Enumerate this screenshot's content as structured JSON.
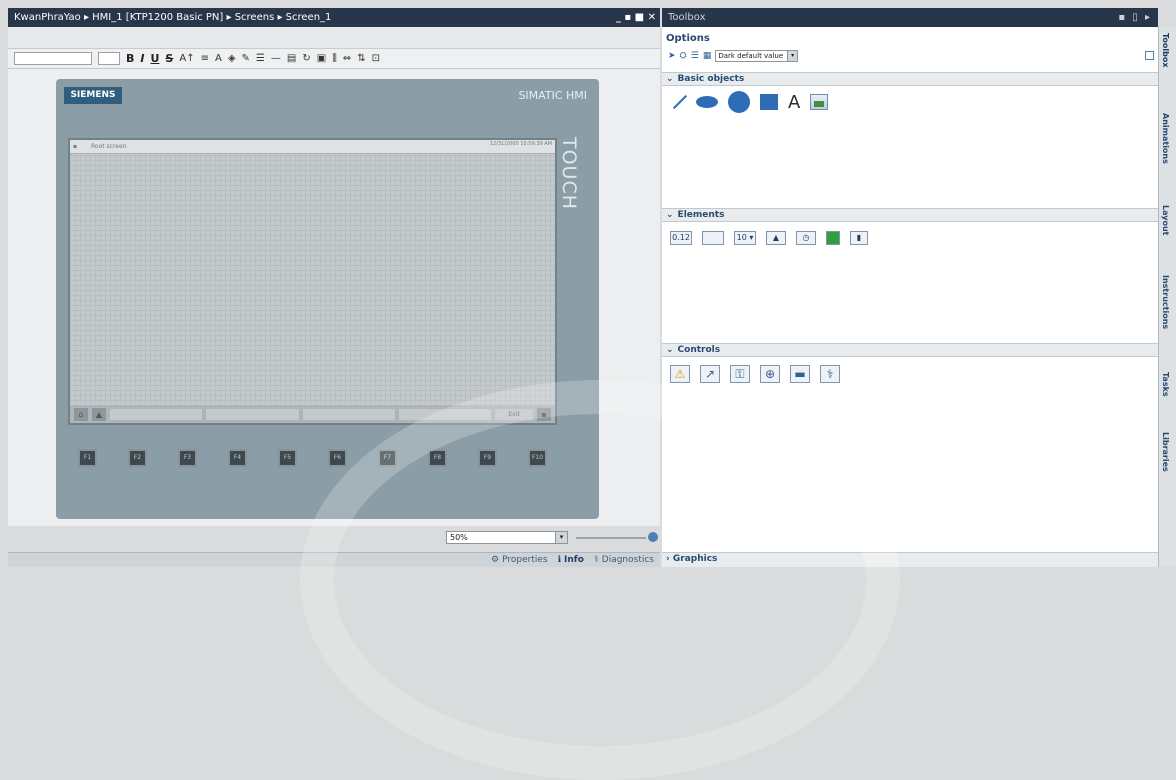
{
  "window": {
    "breadcrumb": "KwanPhraYao  ▸  HMI_1 [KTP1200 Basic PN]  ▸  Screens  ▸  Screen_1",
    "controls": "_ ▪ ■ ✕"
  },
  "toolbox_panel": {
    "title": "Toolbox",
    "controls": "▪ ▯ ▸"
  },
  "options": {
    "heading": "Options",
    "style_value": "Dark default value"
  },
  "sections": {
    "basic_objects": "Basic objects",
    "elements": "Elements",
    "controls": "Controls",
    "graphics": "Graphics"
  },
  "elements_icons": [
    "0.12",
    "",
    "10 ▾",
    "",
    "",
    "",
    ""
  ],
  "device": {
    "brand": "SIEMENS",
    "model": "SIMATIC HMI",
    "touch": "TOUCH",
    "screen_header": "Root screen",
    "screen_date": "12/31/2000 10:59:39 AM",
    "exit_label": "Exit",
    "fkeys": [
      "F1",
      "F2",
      "F3",
      "F4",
      "F5",
      "F6",
      "F7",
      "F8",
      "F9",
      "F10"
    ]
  },
  "zoom": {
    "value": "50%"
  },
  "bottom_tabs": {
    "properties": "Properties",
    "info": "Info",
    "diagnostics": "Diagnostics"
  },
  "right_tabs": [
    "Toolbox",
    "Animations",
    "Layout",
    "Instructions",
    "Tasks",
    "Libraries"
  ],
  "colors": {
    "title_bar": "#27364a",
    "accent_blue": "#2e6db5",
    "device_bezel": "#8b9ea7"
  }
}
